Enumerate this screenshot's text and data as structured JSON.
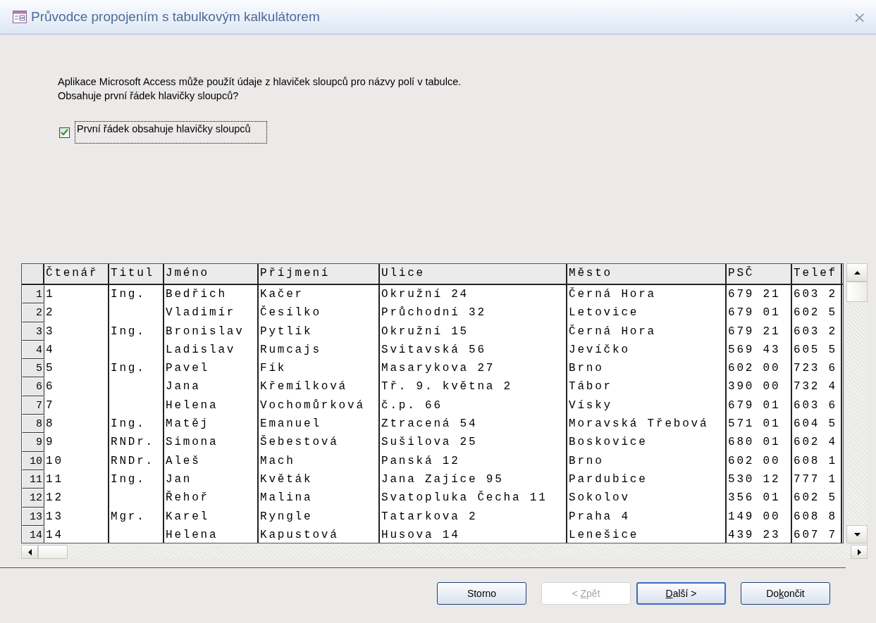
{
  "window": {
    "title": "Průvodce propojením s tabulkovým kalkulátorem",
    "close": "×"
  },
  "intro": [
    "Aplikace Microsoft Access může použít údaje z hlaviček sloupců pro názvy polí v tabulce.",
    "Obsahuje první řádek hlavičky sloupců?"
  ],
  "checkbox": {
    "label": "První řádek obsahuje hlavičky sloupců",
    "checked": true
  },
  "table": {
    "columns": [
      "Čtenář",
      "Titul",
      "Jméno",
      "Příjmení",
      "Ulice",
      "Město",
      "PSČ",
      "Telef"
    ],
    "rows": [
      {
        "number": "1",
        "cells": [
          "1",
          "Ing.",
          "Bedřich",
          "Kačer",
          "Okružní 24",
          "Černá Hora",
          "679 21",
          "603 2"
        ]
      },
      {
        "number": "2",
        "cells": [
          "2",
          null,
          "Vladimír",
          "Česílko",
          "Průchodní 32",
          "Letovice",
          "679 01",
          "602 5"
        ]
      },
      {
        "number": "3",
        "cells": [
          "3",
          "Ing.",
          "Bronislav",
          "Pytlík",
          "Okružní 15",
          "Černá Hora",
          "679 21",
          "603 2"
        ]
      },
      {
        "number": "4",
        "cells": [
          "4",
          null,
          "Ladislav",
          "Rumcajs",
          "Svitavská 56",
          "Jevíčko",
          "569 43",
          "605 5"
        ]
      },
      {
        "number": "5",
        "cells": [
          "5",
          "Ing.",
          "Pavel",
          "Fík",
          "Masarykova 27",
          "Brno",
          "602 00",
          "723 6"
        ]
      },
      {
        "number": "6",
        "cells": [
          "6",
          null,
          "Jana",
          "Křemílková",
          "Tř. 9. května 2",
          "Tábor",
          "390 00",
          "732 4"
        ]
      },
      {
        "number": "7",
        "cells": [
          "7",
          null,
          "Helena",
          "Vochomůrková",
          "č.p. 66",
          "Vísky",
          "679 01",
          "603 6"
        ]
      },
      {
        "number": "8",
        "cells": [
          "8",
          "Ing.",
          "Matěj",
          "Emanuel",
          "Ztracená 54",
          "Moravská Třebová",
          "571 01",
          "604 5"
        ]
      },
      {
        "number": "9",
        "cells": [
          "9",
          "RNDr.",
          "Simona",
          "Šebestová",
          "Sušilova 25",
          "Boskovice",
          "680 01",
          "602 4"
        ]
      },
      {
        "number": "10",
        "cells": [
          "10",
          "RNDr.",
          "Aleš",
          "Mach",
          "Panská 12",
          "Brno",
          "602 00",
          "608 1"
        ]
      },
      {
        "number": "11",
        "cells": [
          "11",
          "Ing.",
          "Jan",
          "Květák",
          "Jana Zajíce 95",
          "Pardubice",
          "530 12",
          "777 1"
        ]
      },
      {
        "number": "12",
        "cells": [
          "12",
          null,
          "Řehoř",
          "Malina",
          "Svatopluka Čecha 11",
          "Sokolov",
          "356 01",
          "602 5"
        ]
      },
      {
        "number": "13",
        "cells": [
          "13",
          "Mgr.",
          "Karel",
          "Ryngle",
          "Tatarkova 2",
          "Praha 4",
          "149 00",
          "608 8"
        ]
      },
      {
        "number": "14",
        "cells": [
          "14",
          null,
          "Helena",
          "Kapustová",
          "Husova 14",
          "Lenešice",
          "439 23",
          "607 7"
        ]
      }
    ]
  },
  "buttons": [
    {
      "label": "Storno",
      "disabled": false,
      "default": false
    },
    {
      "label_before_key": "< ",
      "access_key": "Z",
      "label_after_key": "pět",
      "disabled": true,
      "default": false
    },
    {
      "access_key": "D",
      "label_after_key": "alší >",
      "disabled": false,
      "default": true
    },
    {
      "label_before_key": "Do",
      "access_key": "k",
      "label_after_key": "ončit",
      "disabled": false,
      "default": false
    }
  ]
}
